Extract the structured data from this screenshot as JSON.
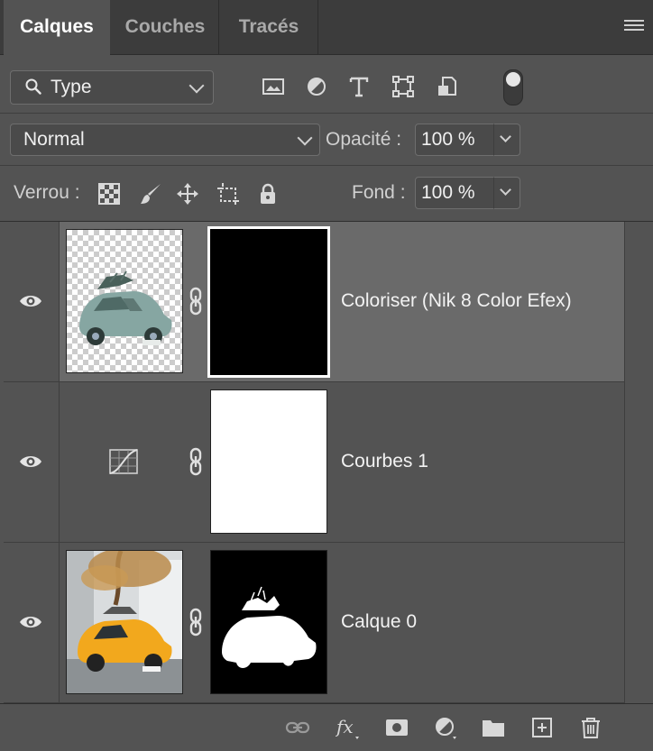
{
  "tabs": [
    {
      "label": "Calques",
      "active": true
    },
    {
      "label": "Couches",
      "active": false
    },
    {
      "label": "Tracés",
      "active": false
    }
  ],
  "filter": {
    "kind_label": "Type",
    "icons": [
      "image-filter-icon",
      "adjustment-filter-icon",
      "type-filter-icon",
      "shape-filter-icon",
      "smart-object-filter-icon"
    ],
    "toggle_on": true
  },
  "blend": {
    "mode": "Normal",
    "opacity_label": "Opacité :",
    "opacity_value": "100 %"
  },
  "lock": {
    "label": "Verrou :",
    "icons": [
      "lock-transparent-pixels-icon",
      "lock-image-pixels-icon",
      "lock-position-icon",
      "lock-artboard-icon",
      "lock-all-icon"
    ],
    "fill_label": "Fond :",
    "fill_value": "100 %"
  },
  "layers": [
    {
      "name": "Coloriser (Nik 8 Color Efex)",
      "visible": true,
      "selected": true,
      "thumb": "transparent-car-teal",
      "mask": "black"
    },
    {
      "name": "Courbes 1",
      "visible": true,
      "selected": false,
      "thumb": "curves-adjustment-icon",
      "mask": "white"
    },
    {
      "name": "Calque 0",
      "visible": true,
      "selected": false,
      "thumb": "photo-yellow-car",
      "mask": "car-silhouette"
    }
  ],
  "bottom_icons": [
    "link-layers-icon",
    "fx-icon",
    "add-mask-icon",
    "new-adjustment-icon",
    "new-group-icon",
    "new-layer-icon",
    "delete-icon"
  ],
  "colors": {
    "panel_bg": "#535353",
    "selected_row": "#6a6a6a",
    "tabbar_bg": "#3c3c3c",
    "text": "#f2f2f2"
  }
}
